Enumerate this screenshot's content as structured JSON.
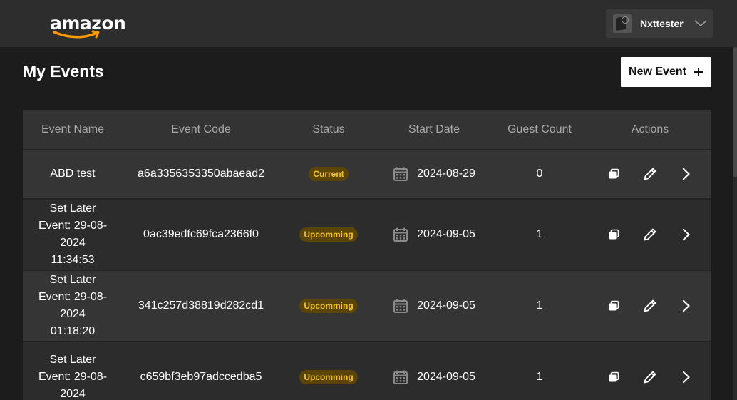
{
  "header": {
    "logo_text": "amazon",
    "username": "Nxttester"
  },
  "page": {
    "title": "My Events",
    "new_event_label": "New Event"
  },
  "table": {
    "columns": [
      "Event Name",
      "Event Code",
      "Status",
      "Start Date",
      "Guest Count",
      "Actions"
    ],
    "rows": [
      {
        "name_lines": [
          "ABD test"
        ],
        "code": "a6a3356353350abaead2",
        "status": "Current",
        "start_date": "2024-08-29",
        "guests": "0"
      },
      {
        "name_lines": [
          "Set Later",
          "Event: 29-08-",
          "2024",
          "11:34:53"
        ],
        "code": "0ac39edfc69fca2366f0",
        "status": "Upcomming",
        "start_date": "2024-09-05",
        "guests": "1"
      },
      {
        "name_lines": [
          "Set Later",
          "Event: 29-08-",
          "2024",
          "01:18:20"
        ],
        "code": "341c257d38819d282cd1",
        "status": "Upcomming",
        "start_date": "2024-09-05",
        "guests": "1"
      },
      {
        "name_lines": [
          "Set Later",
          "Event: 29-08-",
          "2024"
        ],
        "code": "c659bf3eb97adccedba5",
        "status": "Upcomming",
        "start_date": "2024-09-05",
        "guests": "1"
      }
    ]
  },
  "colors": {
    "header_bg": "#2d2d2d",
    "page_bg": "#1c1c1c",
    "badge_bg": "#5a4407",
    "badge_text": "#f2c230"
  },
  "icons": {
    "logo": "amazon-smile-logo",
    "user_menu": "chevron-down-icon",
    "new_event": "plus-icon",
    "date": "calendar-icon",
    "actions": [
      "copy-icon",
      "pencil-icon",
      "chevron-right-icon"
    ]
  }
}
